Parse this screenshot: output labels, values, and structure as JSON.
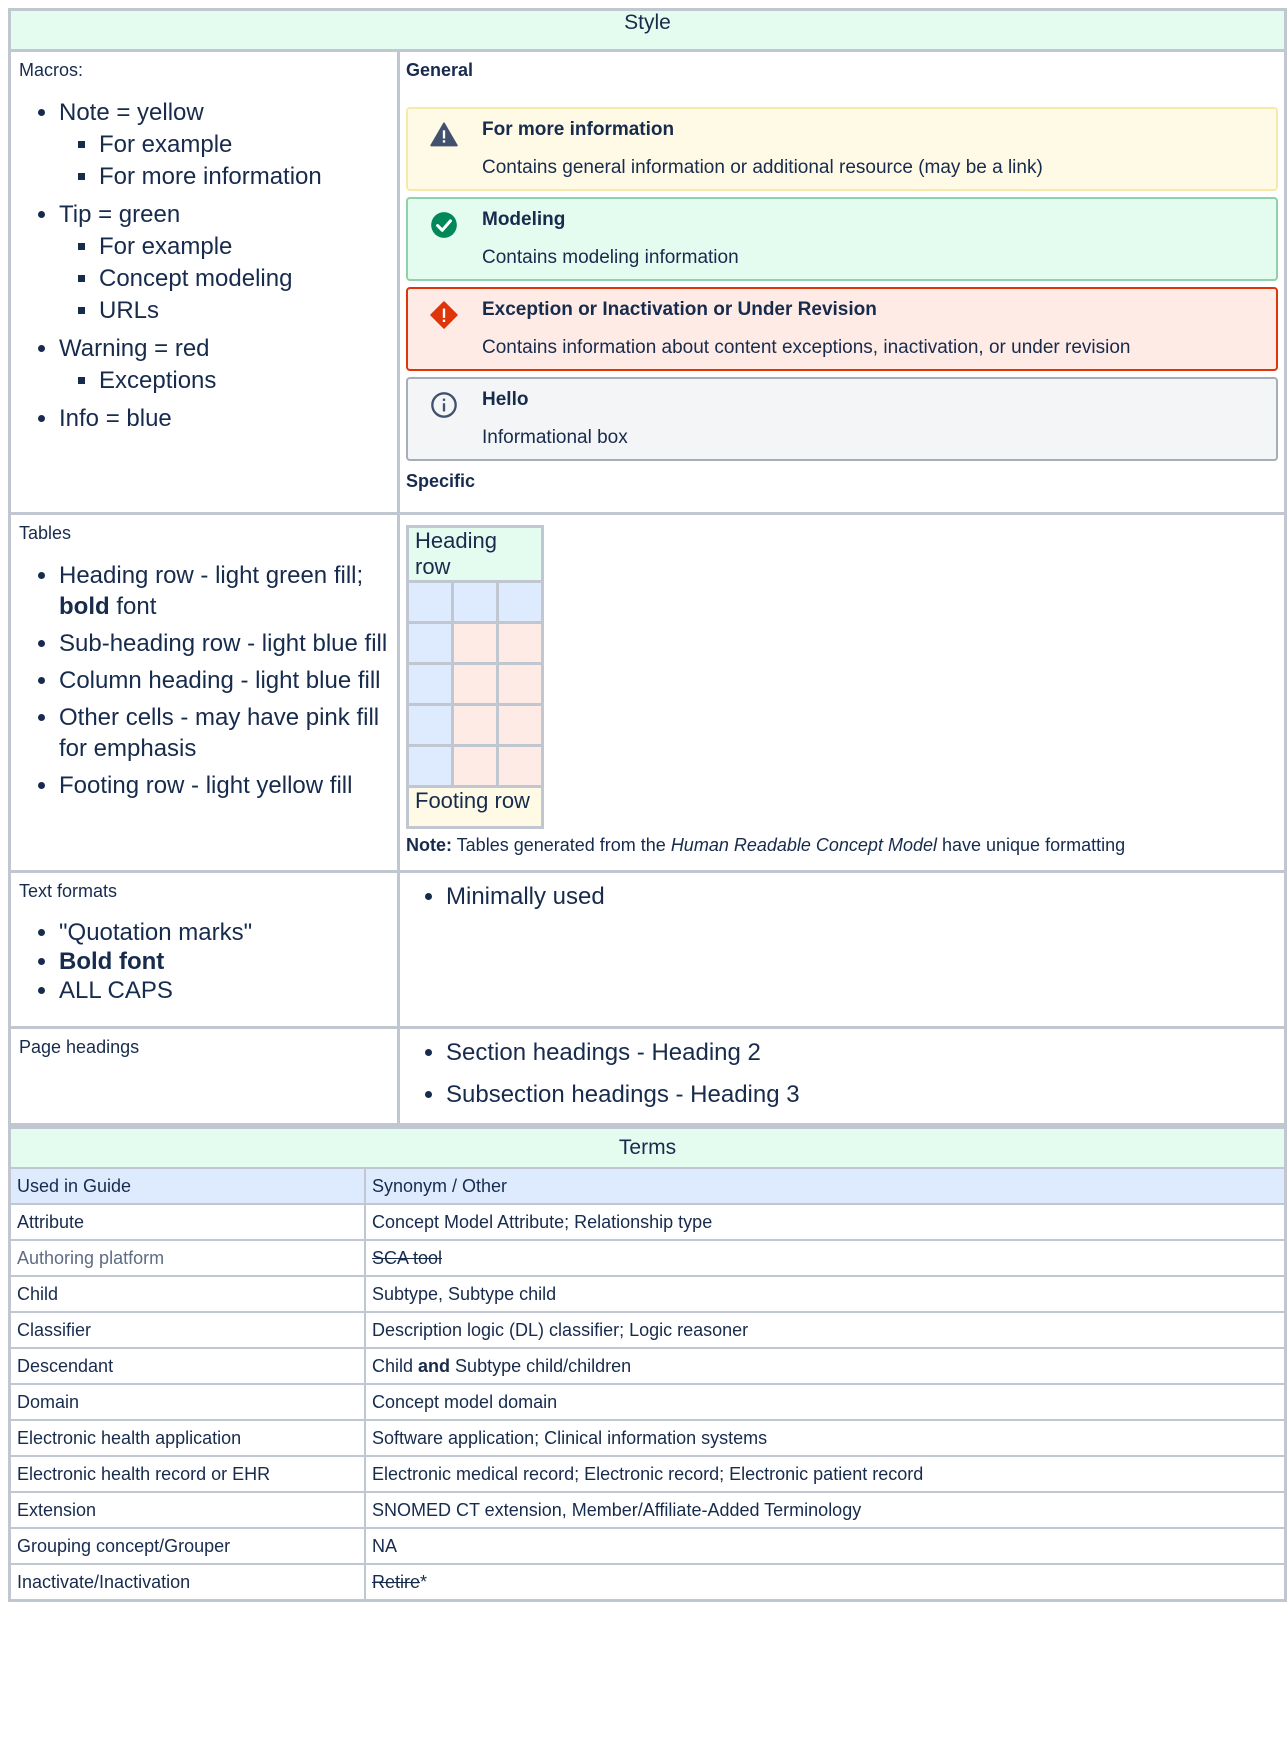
{
  "style_section": {
    "header": "Style",
    "macros": {
      "label": "Macros:",
      "note": "Note = yellow",
      "note_items": [
        "For example",
        "For more information"
      ],
      "tip": "Tip = green",
      "tip_items": [
        "For example",
        "Concept modeling",
        "URLs"
      ],
      "warning": "Warning = red",
      "warning_items": [
        "Exceptions"
      ],
      "info": "Info = blue",
      "general_label": "General",
      "specific_label": "Specific",
      "panels": [
        {
          "title": "For more information",
          "body": "Contains general information or additional resource (may be a link)",
          "icon": "warning-triangle-icon",
          "color": "#fffae6"
        },
        {
          "title": "Modeling",
          "body": "Contains modeling information",
          "icon": "check-circle-icon",
          "color": "#e3fcef"
        },
        {
          "title": "Exception or Inactivation or Under Revision",
          "body": "Contains information about content exceptions, inactivation, or under revision",
          "icon": "error-diamond-icon",
          "color": "#ffebe6"
        },
        {
          "title": "Hello",
          "body": "Informational box",
          "icon": "info-circle-icon",
          "color": "#f4f5f7"
        }
      ]
    },
    "tables": {
      "label": "Tables",
      "items": [
        {
          "pre": "Heading row - light green fill; ",
          "bold": "bold",
          "post": " font"
        },
        {
          "pre": "Sub-heading row - light blue fill",
          "bold": "",
          "post": ""
        },
        {
          "pre": "Column heading - light blue fill",
          "bold": "",
          "post": ""
        },
        {
          "pre": "Other cells - may have pink fill for emphasis",
          "bold": "",
          "post": ""
        },
        {
          "pre": "Footing row - light yellow fill",
          "bold": "",
          "post": ""
        }
      ],
      "sample_heading": "Heading row",
      "sample_footing": "Footing row",
      "note_bold": "Note:",
      "note_pre": " Tables generated from the ",
      "note_italic": "Human Readable Concept Model",
      "note_post": " have unique formatting"
    },
    "text_formats": {
      "label": "Text formats",
      "items": [
        "\"Quotation marks\"",
        "Bold font",
        "ALL CAPS"
      ],
      "right": "Minimally used"
    },
    "page_headings": {
      "label": "Page headings",
      "items": [
        "Section headings - Heading 2",
        "Subsection headings - Heading 3"
      ]
    }
  },
  "terms_section": {
    "header": "Terms",
    "col1": "Used in Guide",
    "col2": "Synonym / Other",
    "rows": [
      {
        "term": "Attribute",
        "syn": "Concept Model Attribute; Relationship type"
      },
      {
        "term": "Authoring platform",
        "syn": "SCA tool"
      },
      {
        "term": "Child",
        "syn": "Subtype, Subtype child"
      },
      {
        "term": "Classifier",
        "syn": "Description logic (DL) classifier; Logic reasoner"
      },
      {
        "term": "Descendant",
        "syn_pre": "Child ",
        "syn_bold": "and",
        "syn_post": " Subtype child/children"
      },
      {
        "term": "Domain",
        "syn": "Concept model domain"
      },
      {
        "term": "Electronic health application",
        "syn": "Software application; Clinical information systems"
      },
      {
        "term": "Electronic health record or EHR",
        "syn": "Electronic medical record; Electronic record; Electronic patient record"
      },
      {
        "term": "Extension",
        "syn": "SNOMED CT extension, Member/Affiliate-Added Terminology"
      },
      {
        "term": "Grouping concept/Grouper",
        "syn": "NA"
      },
      {
        "term": "Inactivate/Inactivation",
        "syn_strike": "Retire",
        "syn_post": "*"
      }
    ]
  }
}
